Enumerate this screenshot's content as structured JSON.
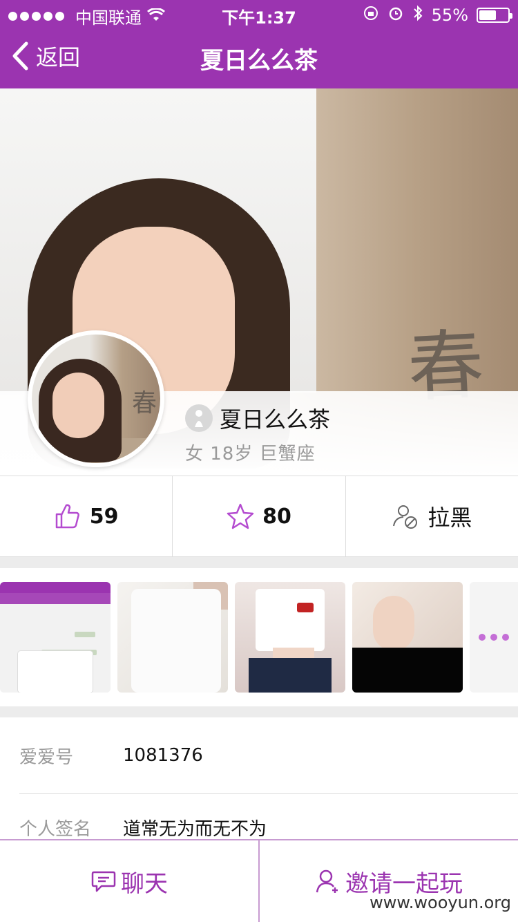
{
  "status_bar": {
    "carrier": "中国联通",
    "time": "下午1:37",
    "battery": "55%"
  },
  "nav": {
    "back_label": "返回",
    "title": "夏日么么茶"
  },
  "hero": {
    "watermark_char": "春"
  },
  "profile": {
    "name": "夏日么么茶",
    "gender_age_sign": "女 18岁  巨蟹座"
  },
  "stats": {
    "likes": "59",
    "favorites": "80",
    "block_label": "拉黑"
  },
  "thumbnails": {
    "more_label": "..."
  },
  "info": {
    "id_label": "爱爱号",
    "id_value": "1081376",
    "signature_label": "个人签名",
    "signature_value": "道常无为而无不为"
  },
  "actions": {
    "chat_label": "聊天",
    "invite_label": "邀请一起玩"
  },
  "watermark": "www.wooyun.org",
  "colors": {
    "brand": "#9b34b0",
    "accent_icon": "#b44bd0"
  }
}
